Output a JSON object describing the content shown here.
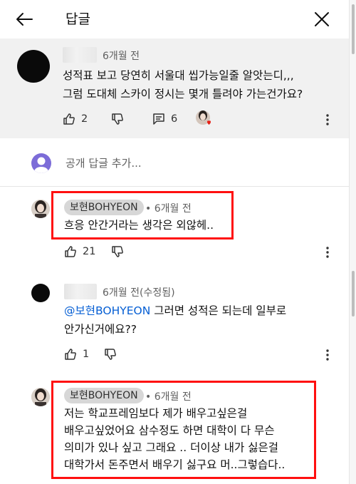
{
  "header": {
    "title": "답글"
  },
  "parent_comment": {
    "time": "6개월 전",
    "lines": [
      "성적표 보고 당연히 서울대 씹가능일줄 알앗는디,,,",
      "그럼 도대체 스카이 정시는 몇개 틀려야 가는건가요?"
    ],
    "likes": "2",
    "replies": "6"
  },
  "add_reply": {
    "placeholder": "공개 답글 추가..."
  },
  "replies": [
    {
      "author": "보현BOHYEON",
      "time": "• 6개월 전",
      "lines": [
        "흐응 안간거라는 생각은 외않헤.."
      ],
      "likes": "21"
    },
    {
      "time": "6개월 전(수정됨)",
      "mention": "@보현BOHYEON",
      "lines": [
        " 그러면 성적은 되는데 일부로",
        "안가신거에요??"
      ],
      "likes": "1"
    },
    {
      "author": "보현BOHYEON",
      "time": "• 6개월 전",
      "lines": [
        "저는 학교프레임보다 제가 배우고싶은걸",
        "배우고싶었어요 삼수정도 하면 대학이 다 무슨",
        "의미가 있나 싶고 그래요 .. 더이상 내가 싫은걸",
        "대학가서 돈주면서 배우기 싫구요 머..그렇습다.."
      ]
    }
  ],
  "colors": {
    "highlight": "#ff0f0f",
    "mention": "#065fd4",
    "parent_bg": "#f1f1f1"
  }
}
